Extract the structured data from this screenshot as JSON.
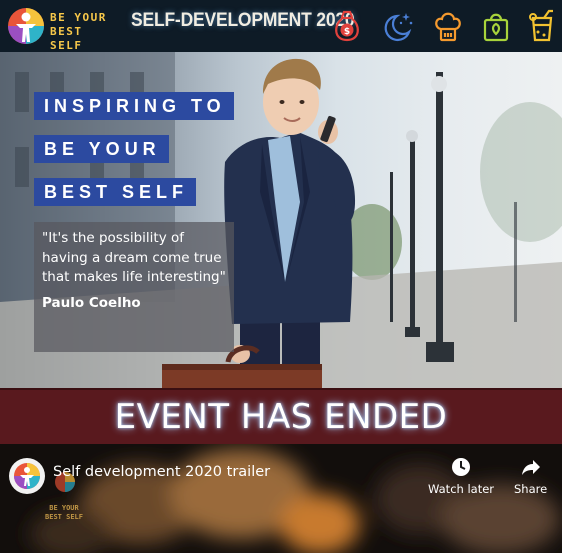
{
  "header": {
    "logo_text_line1": "BE YOUR",
    "logo_text_line2": "BEST SELF",
    "site_title": "SELF-DEVELOPMENT 2020",
    "icons": [
      "money-bag-icon",
      "night-moon-stars-icon",
      "chef-hat-icon",
      "shopping-bag-icon",
      "cocktail-drink-icon"
    ]
  },
  "hero": {
    "heading_lines": [
      "INSPIRING TO",
      "BE YOUR",
      "BEST SELF"
    ],
    "quote": "\"It's the possibility of having a dream come true that makes life interesting\"",
    "author": "Paulo Coelho"
  },
  "banner": {
    "text": "EVENT HAS ENDED"
  },
  "video": {
    "title": "Self development 2020 trailer",
    "watch_later_label": "Watch later",
    "share_label": "Share",
    "watermark_line1": "BE YOUR",
    "watermark_line2": "BEST SELF"
  },
  "colors": {
    "header_bg": "#0e1b26",
    "logo_gold": "#f7c84a",
    "heading_blue": "#2c4aa0",
    "banner_red": "#59191e",
    "icon_red": "#e0413c",
    "icon_blue": "#4a7fd6",
    "icon_orange": "#f59a2e",
    "icon_green": "#a8d33b",
    "icon_yellow": "#f2c230"
  }
}
